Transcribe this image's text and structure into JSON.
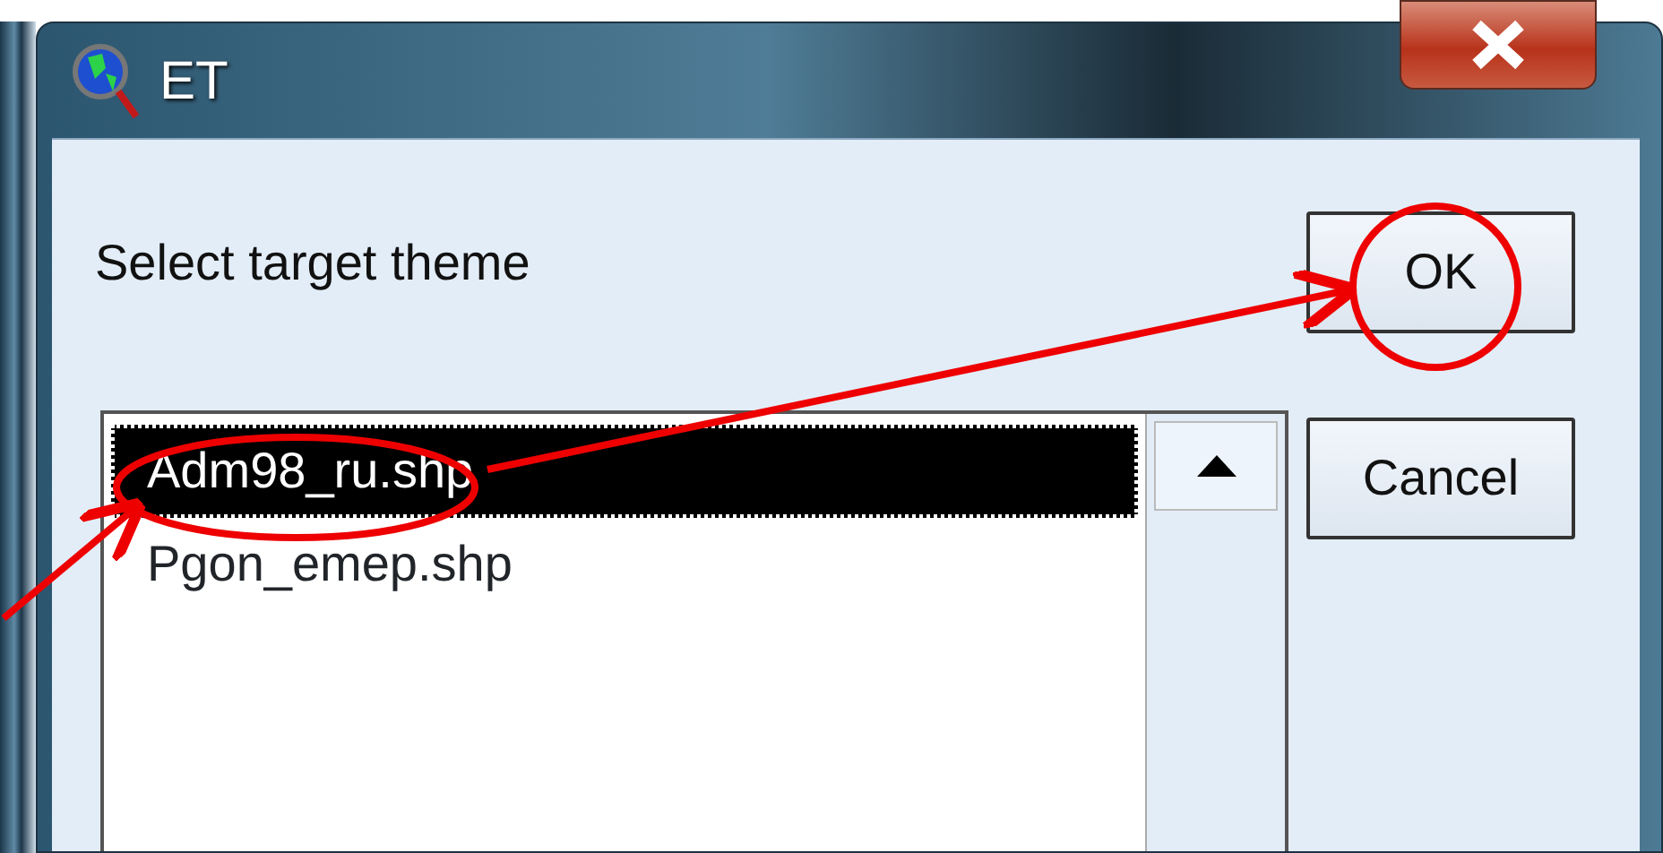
{
  "window": {
    "title": "ET"
  },
  "prompt": "Select target theme",
  "list": {
    "items": [
      {
        "label": "Adm98_ru.shp",
        "selected": true
      },
      {
        "label": "Pgon_emep.shp",
        "selected": false
      }
    ]
  },
  "buttons": [
    {
      "label": "OK"
    },
    {
      "label": "Cancel"
    }
  ]
}
